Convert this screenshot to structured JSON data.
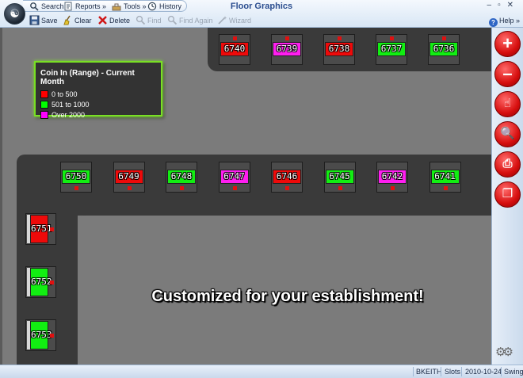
{
  "app": {
    "title": "Floor Graphics"
  },
  "menu": {
    "search": "Search",
    "reports": "Reports",
    "tools": "Tools",
    "history": "History"
  },
  "toolbar": {
    "save": "Save",
    "clear": "Clear",
    "delete": "Delete",
    "find": "Find",
    "find_again": "Find Again",
    "wizard": "Wizard",
    "help": "Help"
  },
  "legend": {
    "title": "Coin In (Range) - Current Month",
    "items": [
      {
        "label": "0 to 500",
        "color": "#ff0000"
      },
      {
        "label": "501 to 1000",
        "color": "#00ff00"
      },
      {
        "label": "Over 2000",
        "color": "#ff00ff"
      }
    ]
  },
  "colors": {
    "red": "#ee0a0a",
    "green": "#12ee12",
    "magenta": "#ff1ef0",
    "legend_border": "#79e024"
  },
  "machines_top": [
    {
      "id": "6740",
      "status": "red"
    },
    {
      "id": "6739",
      "status": "magenta"
    },
    {
      "id": "6738",
      "status": "red"
    },
    {
      "id": "6737",
      "status": "green"
    },
    {
      "id": "6736",
      "status": "green"
    }
  ],
  "machines_middle": [
    {
      "id": "6750",
      "status": "green"
    },
    {
      "id": "6749",
      "status": "red"
    },
    {
      "id": "6748",
      "status": "green"
    },
    {
      "id": "6747",
      "status": "magenta"
    },
    {
      "id": "6746",
      "status": "red"
    },
    {
      "id": "6745",
      "status": "green"
    },
    {
      "id": "6742",
      "status": "magenta"
    },
    {
      "id": "6741",
      "status": "green"
    }
  ],
  "machines_left": [
    {
      "id": "6751",
      "status": "red"
    },
    {
      "id": "6752",
      "status": "green"
    },
    {
      "id": "6753",
      "status": "green"
    }
  ],
  "banner": {
    "before": "Customized for ",
    "emphasis": "your",
    "after": " establishment!"
  },
  "tools_panel": [
    {
      "name": "add-tool",
      "icon": "plus-icon",
      "glyph": "+"
    },
    {
      "name": "remove-tool",
      "icon": "minus-icon",
      "glyph": "–"
    },
    {
      "name": "select-tool",
      "icon": "hand-pointer-icon",
      "glyph": "☝"
    },
    {
      "name": "zoom-tool",
      "icon": "magnifier-icon",
      "glyph": "🔍"
    },
    {
      "name": "print-tool",
      "icon": "printer-icon",
      "glyph": "⎙"
    },
    {
      "name": "copy-tool",
      "icon": "copy-icon",
      "glyph": "❐"
    }
  ],
  "status": {
    "user": "BKEITH",
    "module": "Slots",
    "date": "2010-10-24",
    "shift": "Swing"
  }
}
